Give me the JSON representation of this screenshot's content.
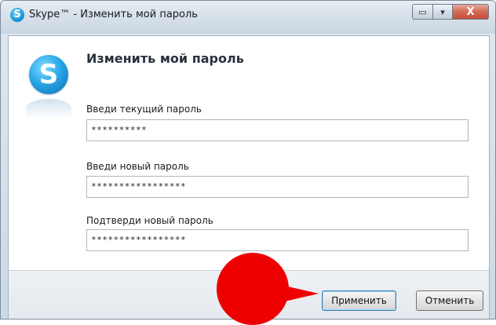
{
  "window": {
    "title": "Skype™ - Изменить мой пароль",
    "app_icon_glyph": "S",
    "controls": {
      "restore_glyph": "▭",
      "minimize_glyph": "▾",
      "close_glyph": "X"
    }
  },
  "dialog": {
    "logo_glyph": "S",
    "heading": "Изменить мой пароль",
    "fields": [
      {
        "label": "Введи текущий пароль",
        "value": "**********"
      },
      {
        "label": "Введи новый пароль",
        "value": "*****************"
      },
      {
        "label": "Подтверди новый пароль",
        "value": "*****************"
      }
    ],
    "buttons": {
      "apply": "Применить",
      "cancel": "Отменить"
    }
  },
  "colors": {
    "accent": "#1592d8",
    "annotation_marker": "#ee0000"
  },
  "icons": [
    "skype-icon",
    "restore-icon",
    "minimize-icon",
    "close-icon",
    "skype-logo-icon"
  ]
}
